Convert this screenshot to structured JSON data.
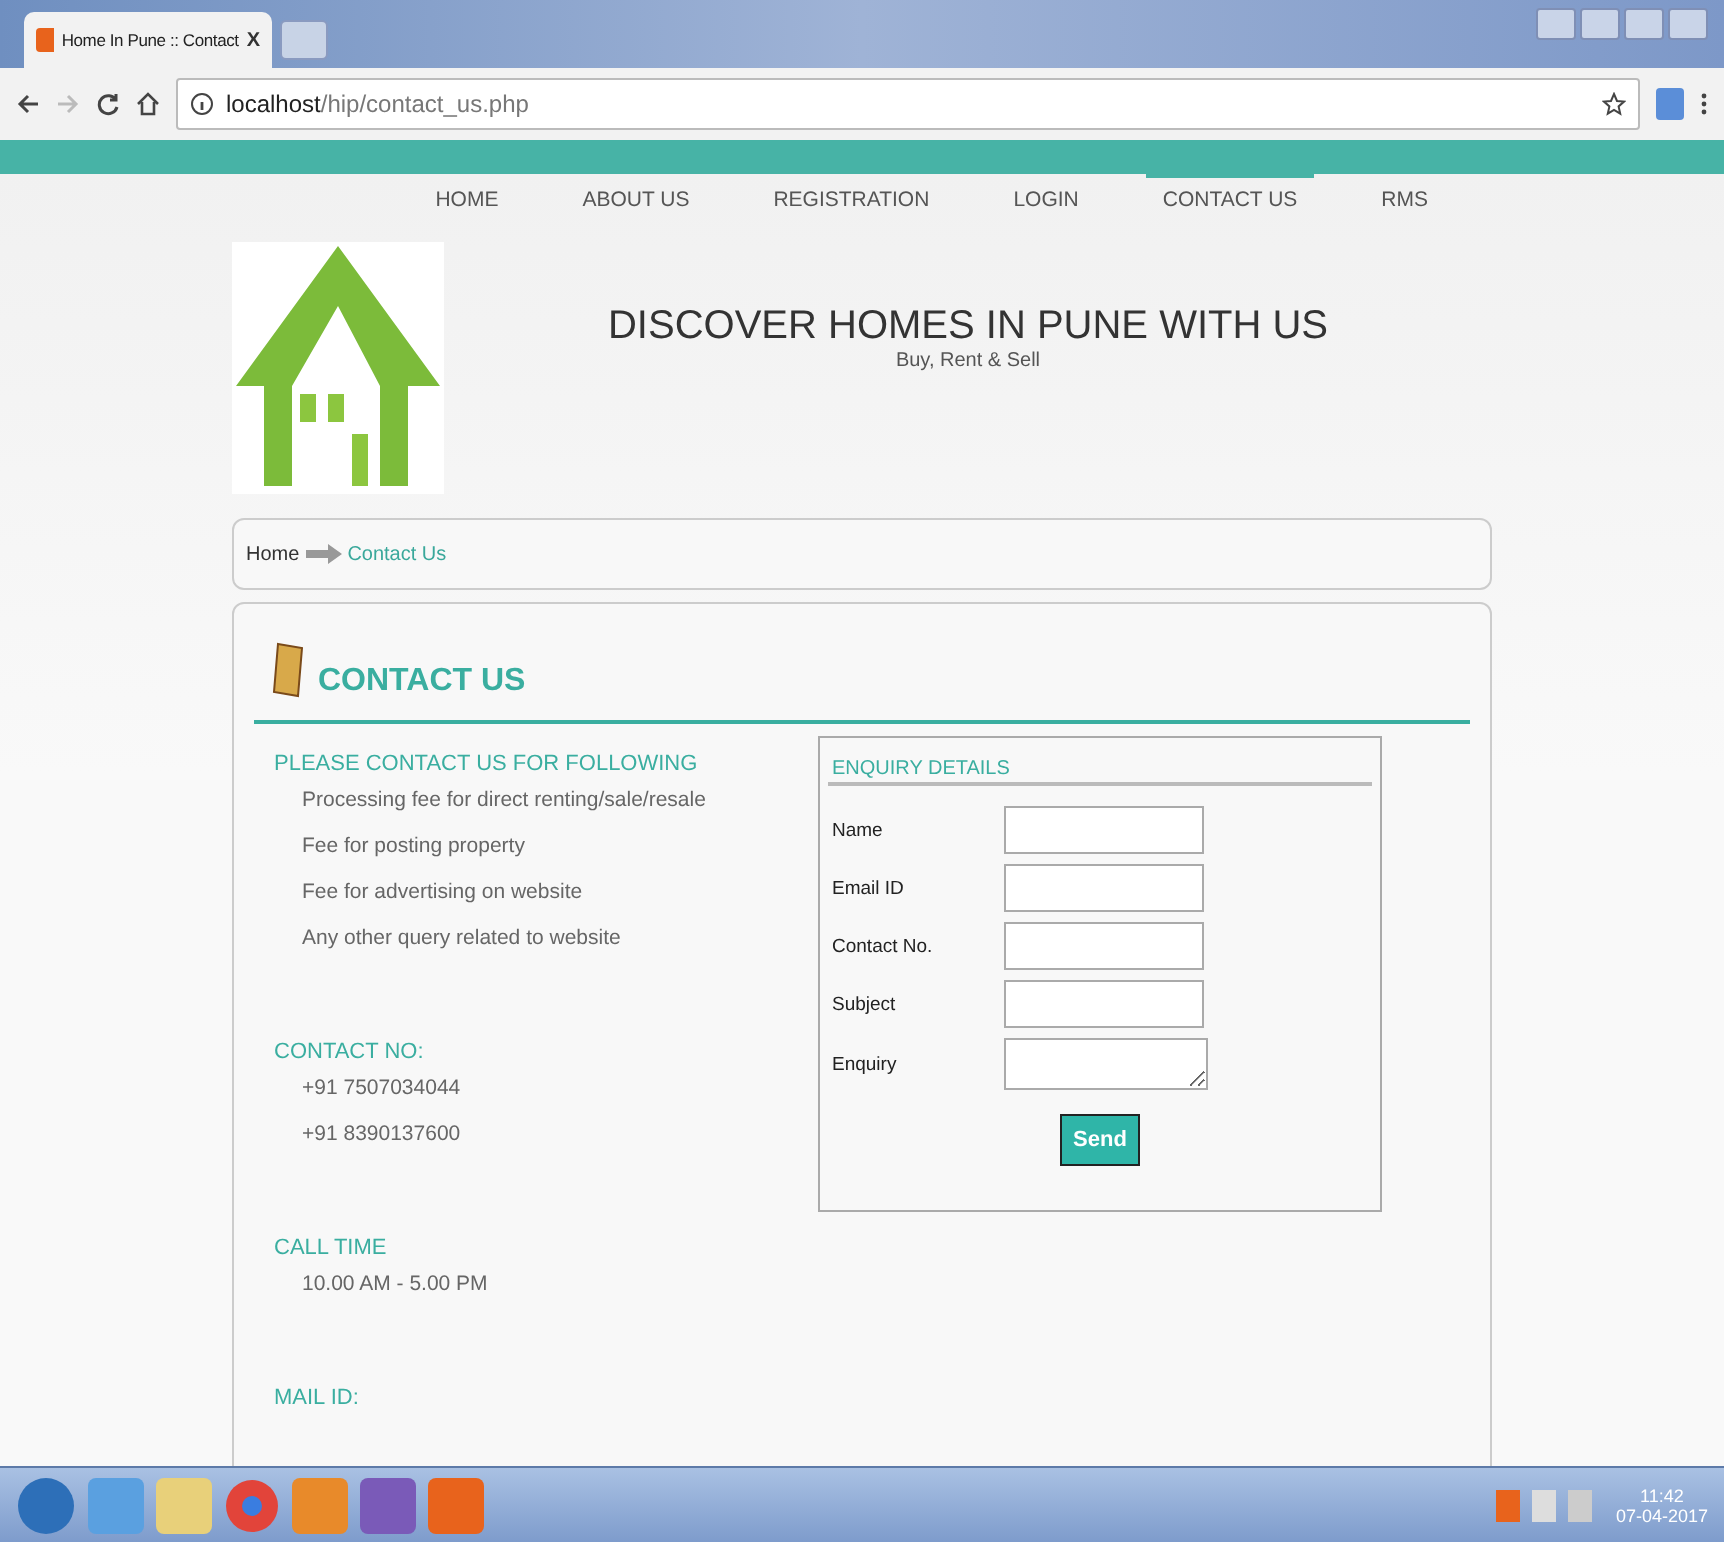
{
  "browser": {
    "tab_title": "Home In Pune :: Contact",
    "tab_close": "X",
    "url_host": "localhost",
    "url_path": "/hip/contact_us.php"
  },
  "nav": [
    {
      "label": "HOME",
      "selected": false
    },
    {
      "label": "ABOUT US",
      "selected": false
    },
    {
      "label": "REGISTRATION",
      "selected": false
    },
    {
      "label": "LOGIN",
      "selected": false
    },
    {
      "label": "CONTACT US",
      "selected": true
    },
    {
      "label": "RMS",
      "selected": false
    }
  ],
  "header": {
    "title": "DISCOVER HOMES IN PUNE WITH US",
    "tagline": "Buy, Rent & Sell"
  },
  "breadcrumb": {
    "home": "Home",
    "current": "Contact Us"
  },
  "page_title": "CONTACT US",
  "sections": [
    {
      "heading": "PLEASE CONTACT US FOR FOLLOWING",
      "items": [
        "Processing fee for direct renting/sale/resale",
        "Fee for posting property",
        "Fee for advertising on website",
        "Any other query related to website"
      ]
    },
    {
      "heading": "CONTACT NO:",
      "items": [
        "+91 7507034044",
        "+91 8390137600"
      ]
    },
    {
      "heading": "CALL TIME",
      "items": [
        "10.00 AM - 5.00 PM"
      ]
    },
    {
      "heading": "MAIL ID:"
    }
  ],
  "enquiry": {
    "title": "ENQUIRY DETAILS",
    "fields": [
      {
        "label": "Name",
        "kind": "input"
      },
      {
        "label": "Email ID",
        "kind": "input"
      },
      {
        "label": "Contact No.",
        "kind": "input"
      },
      {
        "label": "Subject",
        "kind": "input"
      },
      {
        "label": "Enquiry",
        "kind": "textarea"
      }
    ],
    "button": "Send"
  },
  "taskbar": {
    "time": "11:42",
    "date": "07-04-2017"
  }
}
